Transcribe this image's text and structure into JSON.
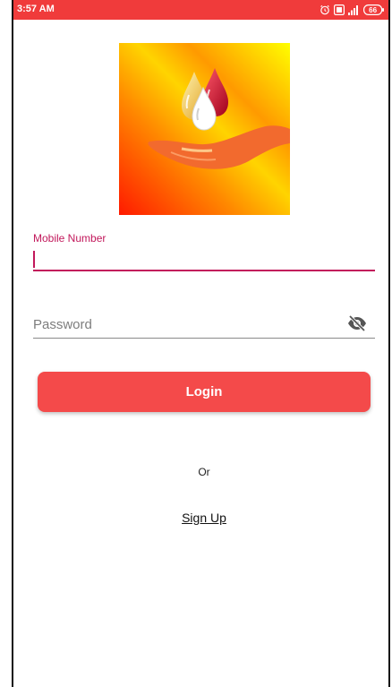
{
  "status_bar": {
    "time": "3:57 AM",
    "battery": "66",
    "icons": [
      "alarm-icon",
      "data-icon",
      "signal-icon",
      "battery-icon"
    ],
    "color": "#f03b3b"
  },
  "logo": {
    "name": "blood-drops-hand-logo",
    "colors": {
      "gradient_start": "#ff0000",
      "gradient_end": "#ffff00",
      "hand": "#f26a2e",
      "drop_red": "#c8102e",
      "drop_white": "#ffffff",
      "drop_yellow": "#f7c948"
    }
  },
  "form": {
    "mobile": {
      "label": "Mobile Number",
      "value": "",
      "accent_color": "#c2185b"
    },
    "password": {
      "placeholder": "Password",
      "value": "",
      "toggle_icon": "eye-off-icon"
    }
  },
  "actions": {
    "login_label": "Login",
    "login_color": "#f44a4a",
    "or_label": "Or",
    "signup_label": "Sign Up"
  }
}
